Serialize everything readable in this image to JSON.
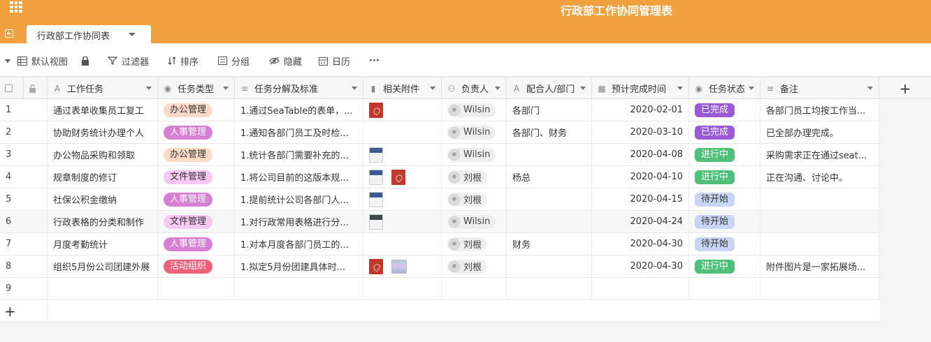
{
  "app": {
    "title": "行政部工作协同管理表",
    "table_tab": "行政部工作协同表"
  },
  "toolbar": {
    "view": "默认视图",
    "filter": "过滤器",
    "sort": "排序",
    "group": "分组",
    "hide": "隐藏",
    "calendar": "日历",
    "more": "···"
  },
  "columns": [
    {
      "label": "工作任务",
      "icon": "text-icon"
    },
    {
      "label": "任务类型",
      "icon": "single-select-icon"
    },
    {
      "label": "任务分解及标准",
      "icon": "long-text-icon"
    },
    {
      "label": "相关附件",
      "icon": "file-icon"
    },
    {
      "label": "负责人",
      "icon": "collaborator-icon"
    },
    {
      "label": "配合人/部门",
      "icon": "text-icon"
    },
    {
      "label": "预计完成时间",
      "icon": "date-icon"
    },
    {
      "label": "任务状态",
      "icon": "single-select-icon"
    },
    {
      "label": "备注",
      "icon": "long-text-icon"
    }
  ],
  "rows": [
    {
      "n": "1",
      "task": "通过表单收集员工复工",
      "type": "办公管理",
      "detail": "1.通过SeaTable的表单，...",
      "files": [
        "pdf"
      ],
      "owner": "Wilsin",
      "partner": "各部门",
      "date": "2020-02-01",
      "status": "已完成",
      "note": "各部门员工均按工作当..."
    },
    {
      "n": "2",
      "task": "协助财务统计办理个人",
      "type": "人事管理",
      "detail": "1.通知各部门员工及时检...",
      "files": [],
      "owner": "Wilsin",
      "partner": "各部门、财务",
      "date": "2020-03-10",
      "status": "已完成",
      "note": "已全部办理完成。"
    },
    {
      "n": "3",
      "task": "办公物品采购和领取",
      "type": "办公管理",
      "detail": "1.统计各部门需要补充的...",
      "files": [
        "doc"
      ],
      "owner": "Wilsin",
      "partner": "",
      "date": "2020-04-08",
      "status": "进行中",
      "note": "采购需求正在通过seat..."
    },
    {
      "n": "4",
      "task": "规章制度的修订",
      "type": "文件管理",
      "detail": "1.将公司目前的这版本规...",
      "files": [
        "doc",
        "pdf"
      ],
      "owner": "刘根",
      "partner": "杨总",
      "date": "2020-04-10",
      "status": "进行中",
      "note": "正在沟通、讨论中。"
    },
    {
      "n": "5",
      "task": "社保公积金缴纳",
      "type": "人事管理",
      "detail": "1.提前统计公司各部门人...",
      "files": [
        "doc"
      ],
      "owner": "刘根",
      "partner": "",
      "date": "2020-04-15",
      "status": "待开始",
      "note": ""
    },
    {
      "n": "6",
      "task": "行政表格的分类和制作",
      "type": "文件管理",
      "detail": "1.对行政常用表格进行分...",
      "files": [
        "xls"
      ],
      "owner": "Wilsin",
      "partner": "",
      "date": "2020-04-24",
      "status": "待开始",
      "note": ""
    },
    {
      "n": "7",
      "task": "月度考勤统计",
      "type": "人事管理",
      "detail": "1.对本月度各部门员工的...",
      "files": [],
      "owner": "刘根",
      "partner": "财务",
      "date": "2020-04-30",
      "status": "待开始",
      "note": ""
    },
    {
      "n": "8",
      "task": "组织5月份公司团建外展",
      "type": "活动组织",
      "detail": "1.拟定5月份团建具体时...",
      "files": [
        "pdf",
        "img"
      ],
      "owner": "刘根",
      "partner": "",
      "date": "2020-04-30",
      "status": "进行中",
      "note": "附件图片是一家拓展场..."
    },
    {
      "n": "9",
      "task": "",
      "type": "",
      "detail": "",
      "files": [],
      "owner": "",
      "partner": "",
      "date": "",
      "status": "",
      "note": ""
    }
  ],
  "type_colors": {
    "办公管理": {
      "bg": "#fdd9c8",
      "fg": "#333333"
    },
    "人事管理": {
      "bg": "#d77fd4",
      "fg": "#ffffff"
    },
    "文件管理": {
      "bg": "#f8c8f2",
      "fg": "#333333"
    },
    "活动组织": {
      "bg": "#ee5f79",
      "fg": "#ffffff"
    }
  },
  "status_colors": {
    "已完成": {
      "bg": "#9a5ad6",
      "fg": "#ffffff"
    },
    "进行中": {
      "bg": "#4ec07a",
      "fg": "#ffffff"
    },
    "待开始": {
      "bg": "#c9d5f5",
      "fg": "#333333"
    }
  },
  "add_row": "+",
  "add_column": "+"
}
